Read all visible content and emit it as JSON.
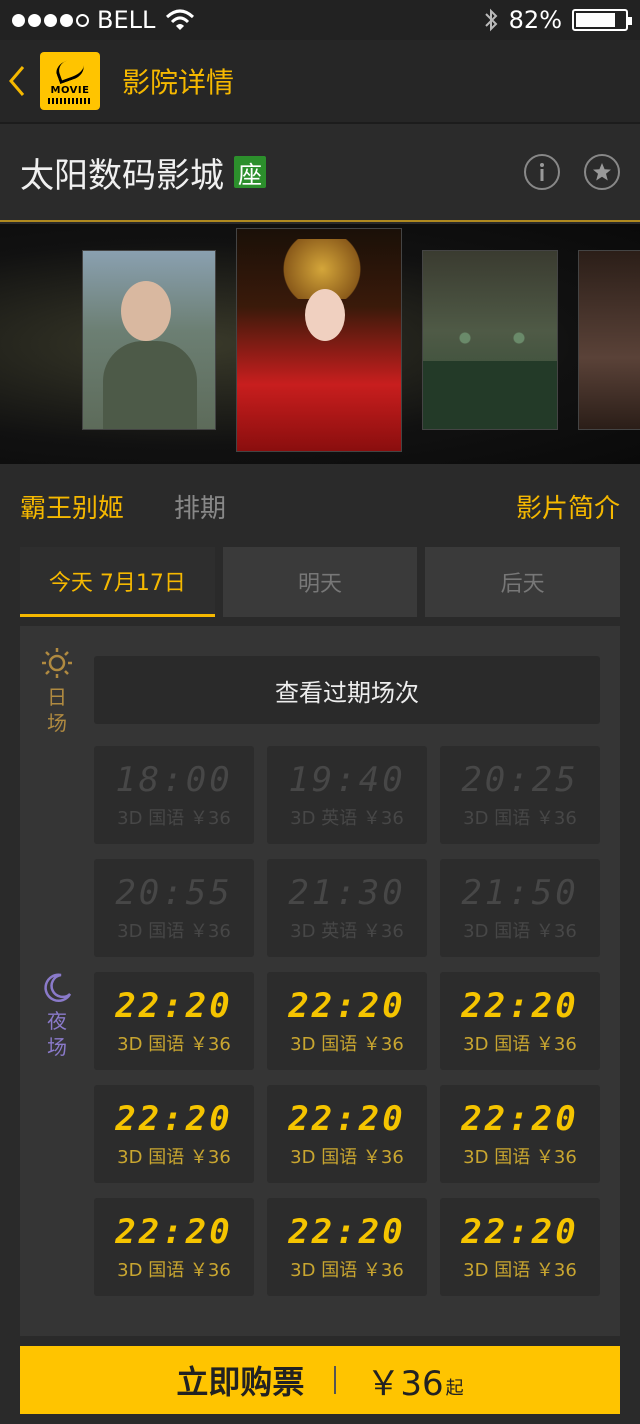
{
  "status_bar": {
    "carrier": "BELL",
    "battery": "82%",
    "battery_level": 0.82,
    "signal_bars": 4
  },
  "nav": {
    "logo_text": "MOVIE",
    "title": "影院详情"
  },
  "cinema": {
    "name": "太阳数码影城",
    "seat_badge": "座",
    "info_icon": "info-icon",
    "favorite_icon": "star-icon"
  },
  "movie": {
    "title": "霸王别姬",
    "schedule_label": "排期",
    "intro_link": "影片简介"
  },
  "day_tabs": [
    {
      "label": "今天 7月17日",
      "active": true
    },
    {
      "label": "明天",
      "active": false
    },
    {
      "label": "后天",
      "active": false
    }
  ],
  "periods": {
    "day": {
      "label_1": "日",
      "label_2": "场",
      "icon": "sun-icon"
    },
    "night": {
      "label_1": "夜",
      "label_2": "场",
      "icon": "moon-icon"
    }
  },
  "past_button": "查看过期场次",
  "showtimes": [
    {
      "time": "18:00",
      "info": "3D 国语 ￥36",
      "past": true
    },
    {
      "time": "19:40",
      "info": "3D 英语 ￥36",
      "past": true
    },
    {
      "time": "20:25",
      "info": "3D 国语 ￥36",
      "past": true
    },
    {
      "time": "20:55",
      "info": "3D 国语 ￥36",
      "past": true
    },
    {
      "time": "21:30",
      "info": "3D 英语 ￥36",
      "past": true
    },
    {
      "time": "21:50",
      "info": "3D 国语 ￥36",
      "past": true
    },
    {
      "time": "22:20",
      "info": "3D 国语 ￥36",
      "past": false
    },
    {
      "time": "22:20",
      "info": "3D 国语 ￥36",
      "past": false
    },
    {
      "time": "22:20",
      "info": "3D 国语 ￥36",
      "past": false
    },
    {
      "time": "22:20",
      "info": "3D 国语 ￥36",
      "past": false
    },
    {
      "time": "22:20",
      "info": "3D 国语 ￥36",
      "past": false
    },
    {
      "time": "22:20",
      "info": "3D 国语 ￥36",
      "past": false
    },
    {
      "time": "22:20",
      "info": "3D 国语 ￥36",
      "past": false
    },
    {
      "time": "22:20",
      "info": "3D 国语 ￥36",
      "past": false
    },
    {
      "time": "22:20",
      "info": "3D 国语 ￥36",
      "past": false
    }
  ],
  "buy": {
    "label": "立即购票",
    "price": "￥36",
    "suffix": "起"
  },
  "colors": {
    "accent": "#ffc400",
    "gold_text": "#f5b800",
    "background": "#2a2a2a",
    "seat_badge": "#2c8f2c",
    "night": "#8a7aca"
  }
}
